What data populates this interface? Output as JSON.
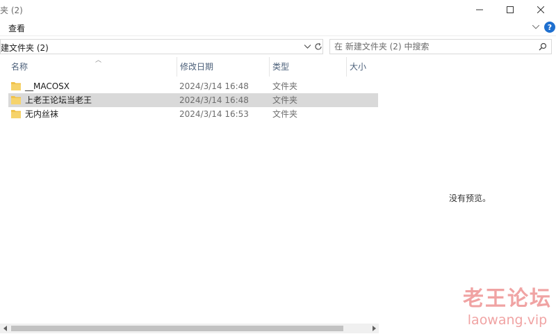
{
  "window": {
    "title": "夹 (2)"
  },
  "ribbon": {
    "tab_view": "查看",
    "help": "?"
  },
  "address": {
    "path": "建文件夹 (2)"
  },
  "search": {
    "placeholder": "在 新建文件夹 (2) 中搜索"
  },
  "columns": {
    "name": "名称",
    "date_modified": "修改日期",
    "type": "类型",
    "size": "大小"
  },
  "files": [
    {
      "name": "__MACOSX",
      "date": "2024/3/14 16:48",
      "type": "文件夹",
      "selected": false
    },
    {
      "name": "上老王论坛当老王",
      "date": "2024/3/14 16:48",
      "type": "文件夹",
      "selected": true
    },
    {
      "name": "无内丝袜",
      "date": "2024/3/14 16:53",
      "type": "文件夹",
      "selected": false
    }
  ],
  "preview": {
    "message": "没有预览。"
  },
  "watermark": {
    "line1": "老王论坛",
    "line2": "laowang.vip"
  },
  "colors": {
    "folder": "#f0c24a",
    "selected_row": "#d9d9d9",
    "help_blue": "#1e6fcf",
    "watermark": "#f0a3a3"
  }
}
